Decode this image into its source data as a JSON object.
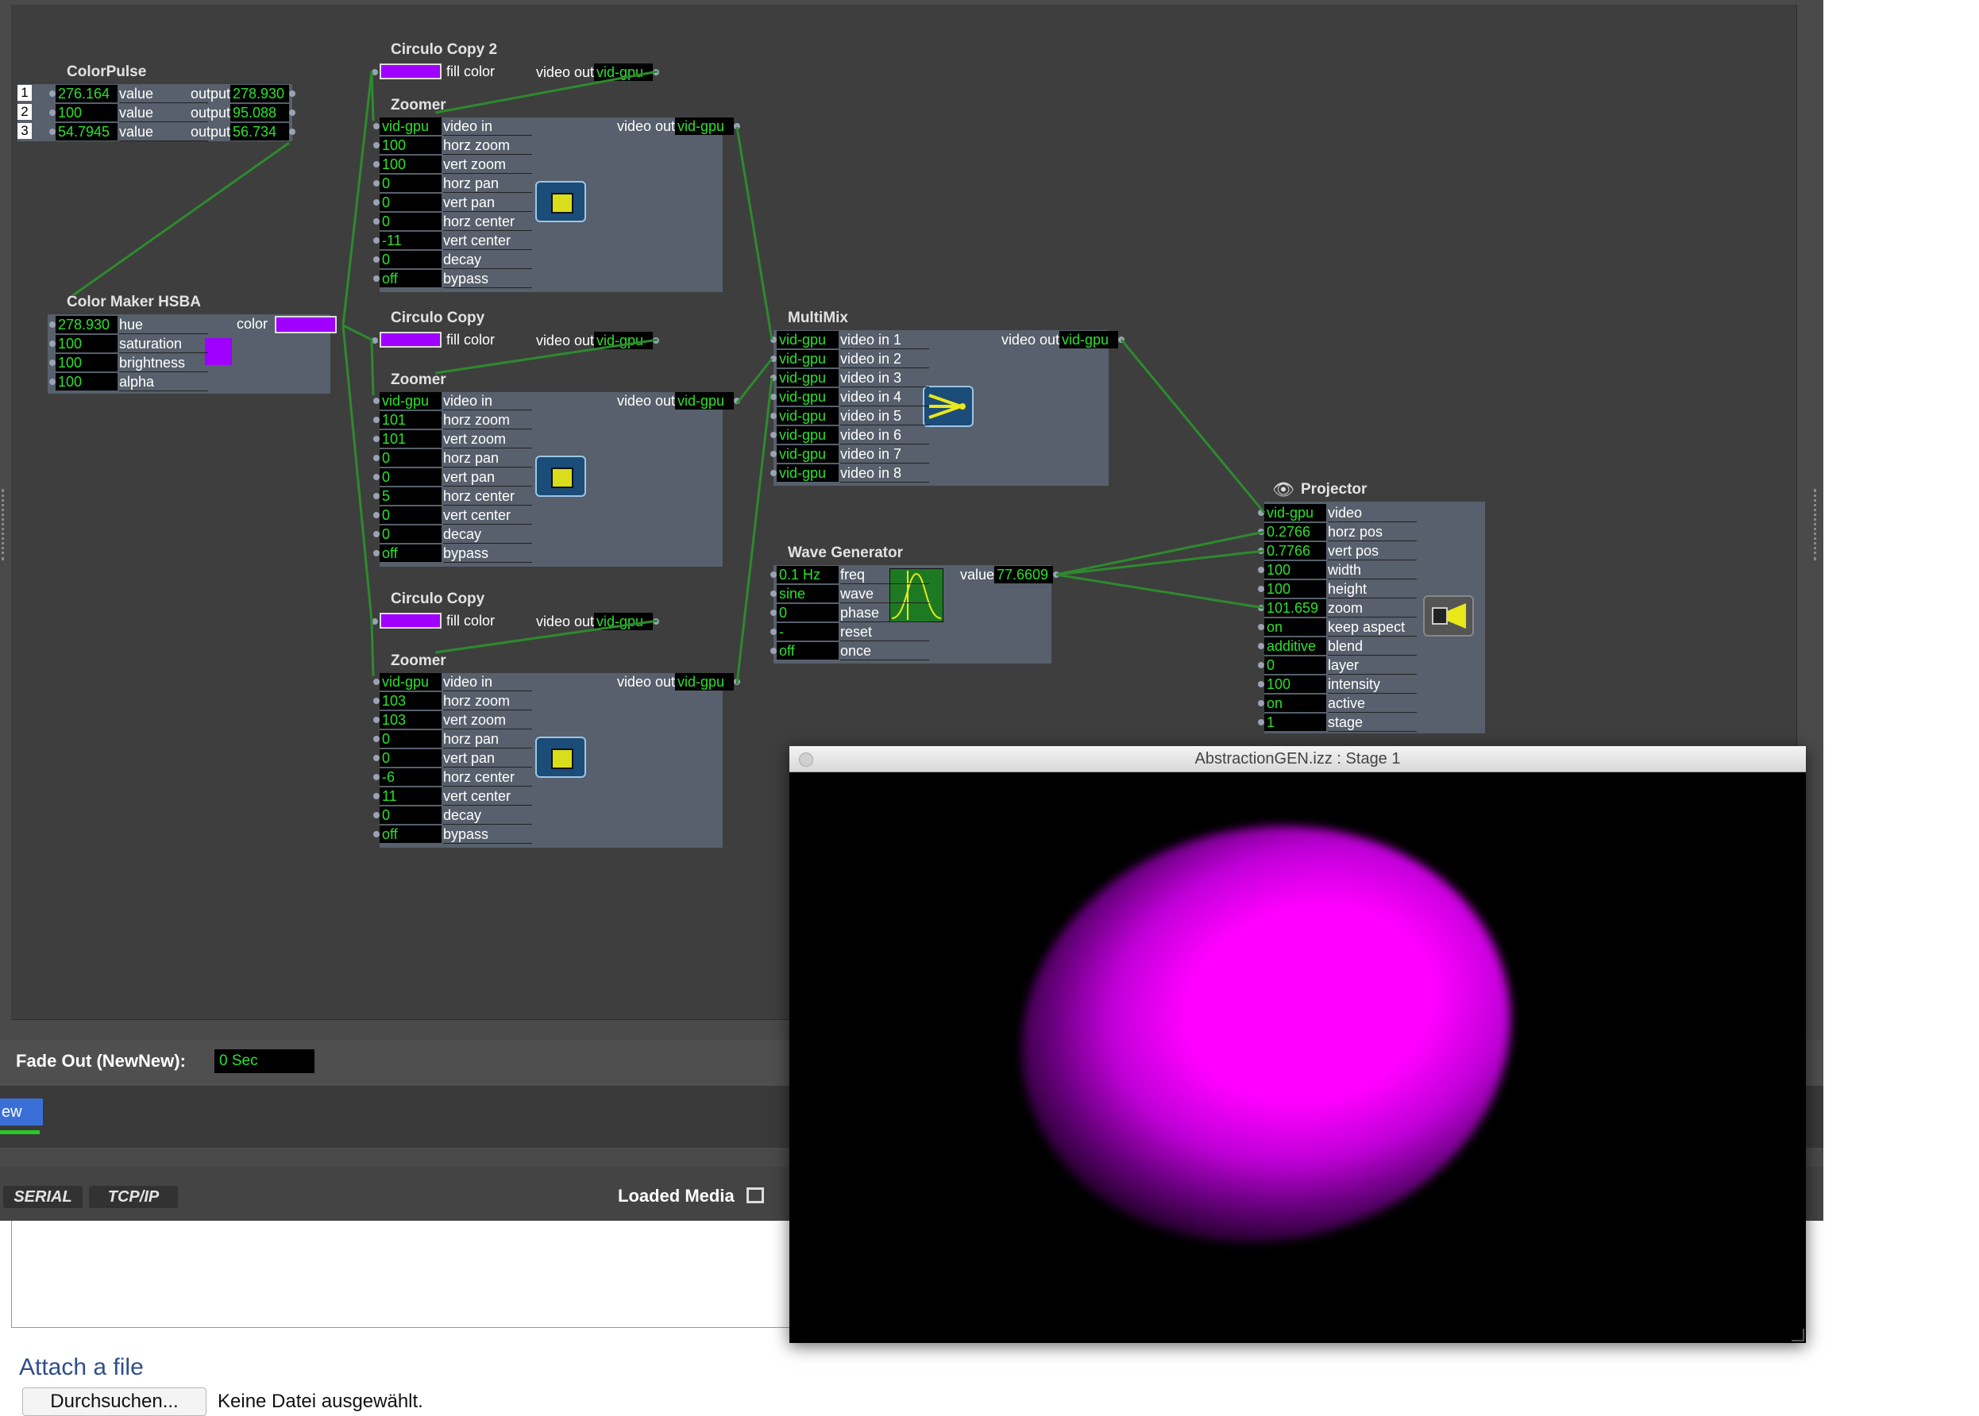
{
  "colors": {
    "wire": "#2d8a2d",
    "value_text": "#2be02b",
    "panel": "#57606c",
    "canvas": "#3e3e3e",
    "swatch": "#a000ff",
    "blob": "#ff00ff"
  },
  "color_pulse": {
    "title": "ColorPulse",
    "rows": [
      {
        "n": "1",
        "in": "276.164",
        "lbl": "value",
        "olbl": "output",
        "out": "278.930"
      },
      {
        "n": "2",
        "in": "100",
        "lbl": "value",
        "olbl": "output",
        "out": "95.088"
      },
      {
        "n": "3",
        "in": "54.7945",
        "lbl": "value",
        "olbl": "output",
        "out": "56.734"
      }
    ]
  },
  "color_maker": {
    "title": "Color Maker HSBA",
    "out_label": "color",
    "rows": [
      {
        "v": "278.930",
        "l": "hue"
      },
      {
        "v": "100",
        "l": "saturation"
      },
      {
        "v": "100",
        "l": "brightness"
      },
      {
        "v": "100",
        "l": "alpha"
      }
    ]
  },
  "circulo": [
    {
      "title": "Circulo Copy 2",
      "in": "fill color",
      "olbl": "video out",
      "out": "vid-gpu"
    },
    {
      "title": "Circulo Copy",
      "in": "fill color",
      "olbl": "video out",
      "out": "vid-gpu"
    },
    {
      "title": "Circulo Copy",
      "in": "fill color",
      "olbl": "video out",
      "out": "vid-gpu"
    }
  ],
  "zoomers": [
    {
      "title": "Zoomer",
      "olbl": "video out",
      "out": "vid-gpu",
      "rows": [
        {
          "v": "vid-gpu",
          "l": "video in"
        },
        {
          "v": "100",
          "l": "horz zoom"
        },
        {
          "v": "100",
          "l": "vert zoom"
        },
        {
          "v": "0",
          "l": "horz pan"
        },
        {
          "v": "0",
          "l": "vert pan"
        },
        {
          "v": "0",
          "l": "horz center"
        },
        {
          "v": "-11",
          "l": "vert center"
        },
        {
          "v": "0",
          "l": "decay"
        },
        {
          "v": "off",
          "l": "bypass"
        }
      ]
    },
    {
      "title": "Zoomer",
      "olbl": "video out",
      "out": "vid-gpu",
      "rows": [
        {
          "v": "vid-gpu",
          "l": "video in"
        },
        {
          "v": "101",
          "l": "horz zoom"
        },
        {
          "v": "101",
          "l": "vert zoom"
        },
        {
          "v": "0",
          "l": "horz pan"
        },
        {
          "v": "0",
          "l": "vert pan"
        },
        {
          "v": "5",
          "l": "horz center"
        },
        {
          "v": "0",
          "l": "vert center"
        },
        {
          "v": "0",
          "l": "decay"
        },
        {
          "v": "off",
          "l": "bypass"
        }
      ]
    },
    {
      "title": "Zoomer",
      "olbl": "video out",
      "out": "vid-gpu",
      "rows": [
        {
          "v": "vid-gpu",
          "l": "video in"
        },
        {
          "v": "103",
          "l": "horz zoom"
        },
        {
          "v": "103",
          "l": "vert zoom"
        },
        {
          "v": "0",
          "l": "horz pan"
        },
        {
          "v": "0",
          "l": "vert pan"
        },
        {
          "v": "-6",
          "l": "horz center"
        },
        {
          "v": "11",
          "l": "vert center"
        },
        {
          "v": "0",
          "l": "decay"
        },
        {
          "v": "off",
          "l": "bypass"
        }
      ]
    }
  ],
  "multimix": {
    "title": "MultiMix",
    "olbl": "video out",
    "out": "vid-gpu",
    "rows": [
      {
        "v": "vid-gpu",
        "l": "video in 1"
      },
      {
        "v": "vid-gpu",
        "l": "video in 2"
      },
      {
        "v": "vid-gpu",
        "l": "video in 3"
      },
      {
        "v": "vid-gpu",
        "l": "video in 4"
      },
      {
        "v": "vid-gpu",
        "l": "video in 5"
      },
      {
        "v": "vid-gpu",
        "l": "video in 6"
      },
      {
        "v": "vid-gpu",
        "l": "video in 7"
      },
      {
        "v": "vid-gpu",
        "l": "video in 8"
      }
    ]
  },
  "wave": {
    "title": "Wave Generator",
    "olbl": "value",
    "out": "77.6609",
    "rows": [
      {
        "v": "0.1 Hz",
        "l": "freq"
      },
      {
        "v": "sine",
        "l": "wave"
      },
      {
        "v": "0",
        "l": "phase"
      },
      {
        "v": "-",
        "l": "reset"
      },
      {
        "v": "off",
        "l": "once"
      }
    ]
  },
  "projector": {
    "title": "Projector",
    "rows": [
      {
        "v": "vid-gpu",
        "l": "video"
      },
      {
        "v": "0.2766",
        "l": "horz pos"
      },
      {
        "v": "0.7766",
        "l": "vert pos"
      },
      {
        "v": "100",
        "l": "width"
      },
      {
        "v": "100",
        "l": "height"
      },
      {
        "v": "101.659",
        "l": "zoom"
      },
      {
        "v": "on",
        "l": "keep aspect"
      },
      {
        "v": "additive",
        "l": "blend"
      },
      {
        "v": "0",
        "l": "layer"
      },
      {
        "v": "100",
        "l": "intensity"
      },
      {
        "v": "on",
        "l": "active"
      },
      {
        "v": "1",
        "l": "stage"
      }
    ]
  },
  "fade": {
    "label": "Fade Out (NewNew):",
    "value": "0 Sec"
  },
  "scene_button": "ew",
  "tabs": {
    "serial": "SERIAL",
    "tcpip": "TCP/IP",
    "loaded_media": "Loaded Media"
  },
  "stage": {
    "title": "AbstractionGEN.izz : Stage 1"
  },
  "attach": {
    "heading": "Attach a file",
    "button": "Durchsuchen...",
    "status": "Keine Datei ausgewählt."
  }
}
